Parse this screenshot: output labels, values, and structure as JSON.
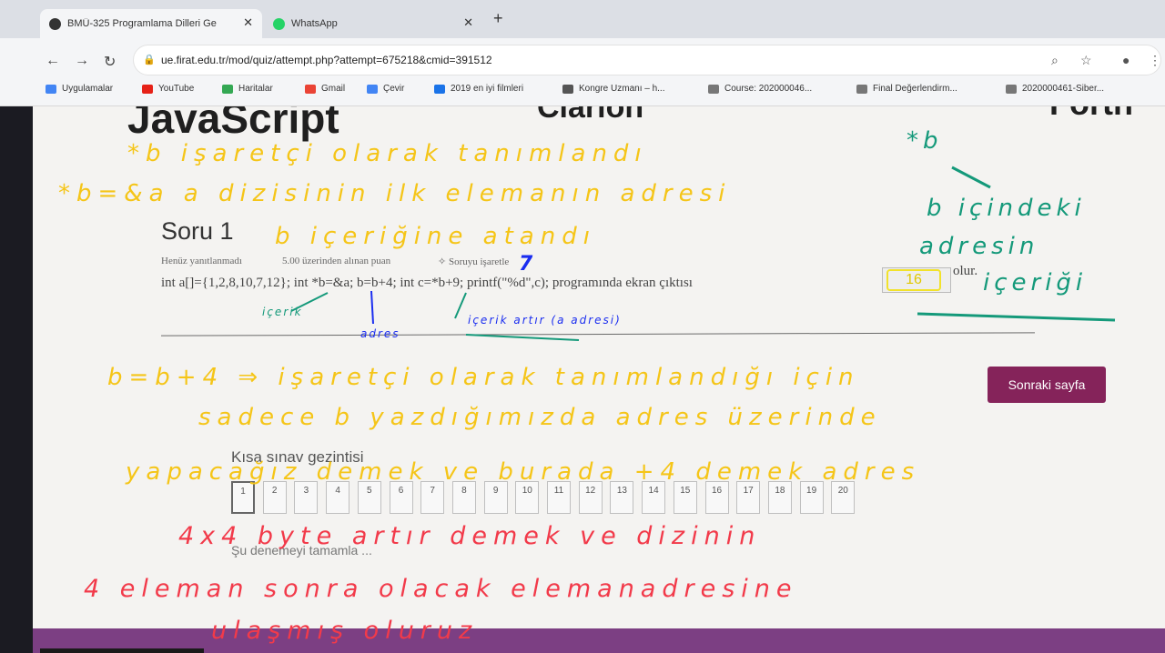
{
  "browser": {
    "tabs": [
      {
        "label": "BMÜ-325 Programlama Dilleri Ge",
        "close": "✕",
        "active": true
      },
      {
        "label": "WhatsApp",
        "close": "✕",
        "active": false
      }
    ],
    "new_tab": "+",
    "url": "ue.firat.edu.tr/mod/quiz/attempt.php?attempt=675218&cmid=391512",
    "bookmarks": [
      {
        "label": "Uygulamalar",
        "color": "#4285f4"
      },
      {
        "label": "YouTube",
        "color": "#e62117"
      },
      {
        "label": "Haritalar",
        "color": "#34a853"
      },
      {
        "label": "Gmail",
        "color": "#ea4335"
      },
      {
        "label": "Çevir",
        "color": "#4285f4"
      },
      {
        "label": "2019 en iyi filmleri",
        "color": "#1a73e8"
      },
      {
        "label": "Kongre Uzmanı – h...",
        "color": "#555555"
      },
      {
        "label": "Course: 202000046...",
        "color": "#777777"
      },
      {
        "label": "Final Değerlendirm...",
        "color": "#777777"
      },
      {
        "label": "2020000461-Siber...",
        "color": "#777777"
      }
    ]
  },
  "page": {
    "logos": [
      "JavaScript",
      "Clarion",
      "Forth"
    ],
    "question": {
      "title": "Soru 1",
      "status": "Henüz yanıtlanmadı",
      "points": "5.00 üzerinden alınan puan",
      "flag": "Soruyu işaretle",
      "text": "int a[]={1,2,8,10,7,12}; int *b=&a; b=b+4; int c=*b+9; printf(\"%d\",c); programında ekran çıktısı",
      "answer": "16",
      "suffix": "olur."
    },
    "next_button": "Sonraki sayfa",
    "nav": {
      "title": "Kısa sınav gezintisi",
      "items": [
        "1",
        "2",
        "3",
        "4",
        "5",
        "6",
        "7",
        "8",
        "9",
        "10",
        "11",
        "12",
        "13",
        "14",
        "15",
        "16",
        "17",
        "18",
        "19",
        "20"
      ],
      "finish": "Şu denemeyi tamamla ..."
    }
  },
  "annotations": {
    "y1": "*b işaretçi olarak tanımlandı",
    "y2": "*b=&a a dizisinin ilk elemanın adresi",
    "y3": "b içeriğine atandı",
    "b1": "7",
    "g1": "*b",
    "g2": "b içindeki",
    "g3": "adresin",
    "g4": "içeriği",
    "g5": "içerik",
    "g6": "adres",
    "g7": "içerik artır (a adresi)",
    "y4": "b=b+4 ⇒ işaretçi olarak tanımlandığı için",
    "y5": "sadece b yazdığımızda adres üzerinde",
    "y6": "yapacağız demek ve burada +4 demek adres",
    "r1": "4x4 byte artır demek ve dizinin",
    "r2": "4 eleman sonra olacak elemanadresine",
    "r3": "ulaşmış oluruz"
  }
}
